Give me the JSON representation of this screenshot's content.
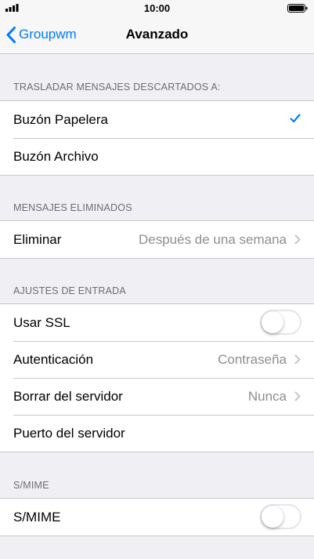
{
  "status": {
    "time": "10:00"
  },
  "nav": {
    "back_label": "Groupwm",
    "title": "Avanzado"
  },
  "sections": {
    "move_discarded": {
      "header": "TRASLADAR MENSAJES DESCARTADOS A:",
      "trash": "Buzón Papelera",
      "archive": "Buzón Archivo"
    },
    "deleted": {
      "header": "MENSAJES ELIMINADOS",
      "delete_label": "Eliminar",
      "delete_value": "Después de una semana"
    },
    "incoming": {
      "header": "AJUSTES DE ENTRADA",
      "ssl_label": "Usar SSL",
      "ssl_on": false,
      "auth_label": "Autenticación",
      "auth_value": "Contraseña",
      "delete_server_label": "Borrar del servidor",
      "delete_server_value": "Nunca",
      "port_label": "Puerto del servidor"
    },
    "smime": {
      "header": "S/MIME",
      "smime_label": "S/MIME",
      "smime_on": false
    }
  },
  "colors": {
    "accent": "#007aff",
    "background": "#efeff4",
    "secondary_text": "#8e8e93"
  }
}
